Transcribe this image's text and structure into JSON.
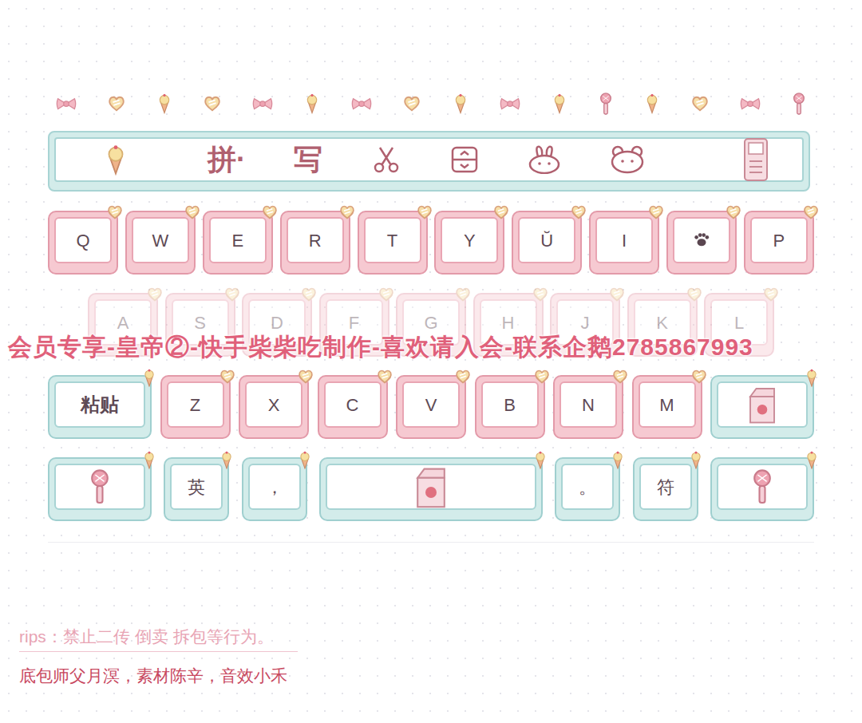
{
  "toolbar": {
    "texts": [
      "拼·",
      "写"
    ]
  },
  "rows": [
    {
      "dimmed": false,
      "keys": [
        {
          "label": "Q",
          "kind": "letter"
        },
        {
          "label": "W",
          "kind": "letter"
        },
        {
          "label": "E",
          "kind": "letter"
        },
        {
          "label": "R",
          "kind": "letter"
        },
        {
          "label": "T",
          "kind": "letter"
        },
        {
          "label": "Y",
          "kind": "letter"
        },
        {
          "label": "Ŭ",
          "kind": "letter"
        },
        {
          "label": "I",
          "kind": "letter"
        },
        {
          "label": "",
          "kind": "paw"
        },
        {
          "label": "P",
          "kind": "letter"
        }
      ]
    },
    {
      "dimmed": true,
      "keys": [
        {
          "label": "A",
          "kind": "letter"
        },
        {
          "label": "S",
          "kind": "letter"
        },
        {
          "label": "D",
          "kind": "letter"
        },
        {
          "label": "F",
          "kind": "letter"
        },
        {
          "label": "G",
          "kind": "letter"
        },
        {
          "label": "H",
          "kind": "letter"
        },
        {
          "label": "J",
          "kind": "letter"
        },
        {
          "label": "K",
          "kind": "letter"
        },
        {
          "label": "L",
          "kind": "letter"
        }
      ]
    },
    {
      "dimmed": false,
      "keys": [
        {
          "label": "粘贴",
          "kind": "wide"
        },
        {
          "label": "Z",
          "kind": "letter"
        },
        {
          "label": "X",
          "kind": "letter"
        },
        {
          "label": "C",
          "kind": "letter"
        },
        {
          "label": "V",
          "kind": "letter"
        },
        {
          "label": "B",
          "kind": "letter"
        },
        {
          "label": "N",
          "kind": "letter"
        },
        {
          "label": "M",
          "kind": "letter"
        },
        {
          "label": "",
          "kind": "milk"
        }
      ]
    },
    {
      "dimmed": false,
      "keys": [
        {
          "label": "",
          "kind": "mic"
        },
        {
          "label": "英",
          "kind": "func"
        },
        {
          "label": "，",
          "kind": "func"
        },
        {
          "label": "",
          "kind": "space"
        },
        {
          "label": "。",
          "kind": "func"
        },
        {
          "label": "符",
          "kind": "func"
        },
        {
          "label": "",
          "kind": "mic"
        }
      ]
    }
  ],
  "watermark": "会员专享-皇帝②-快手柴柴吃制作-喜欢请入会-联系企鹅2785867993",
  "tips": "rips：禁止二传 倒卖 拆包等行为。",
  "credits": "底包师父月溟，素材陈辛，音效小禾"
}
